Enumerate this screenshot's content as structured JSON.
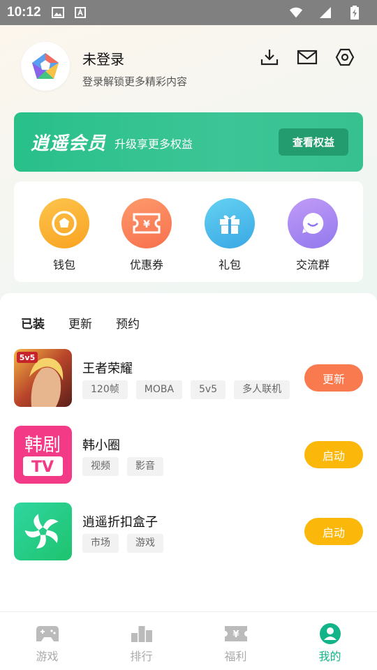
{
  "status_bar": {
    "time": "10:12"
  },
  "profile": {
    "name": "未登录",
    "subtitle": "登录解锁更多精彩内容"
  },
  "vip": {
    "title": "逍遥会员",
    "subtitle": "升级享更多权益",
    "button": "查看权益"
  },
  "quick_actions": [
    {
      "label": "钱包",
      "icon": "wallet-icon",
      "color": "#fba92a"
    },
    {
      "label": "优惠券",
      "icon": "coupon-icon",
      "color": "#fa8060"
    },
    {
      "label": "礼包",
      "icon": "gift-icon",
      "color": "#49bce8"
    },
    {
      "label": "交流群",
      "icon": "chat-icon",
      "color": "#a78af2"
    }
  ],
  "tabs": [
    "已装",
    "更新",
    "预约"
  ],
  "games": [
    {
      "name": "王者荣耀",
      "tags": [
        "120帧",
        "MOBA",
        "5v5",
        "多人联机"
      ],
      "button": "更新",
      "button_color": "#fa7a50"
    },
    {
      "name": "韩小圈",
      "tags": [
        "视频",
        "影音"
      ],
      "button": "启动",
      "button_color": "#fbb80a"
    },
    {
      "name": "逍遥折扣盒子",
      "tags": [
        "市场",
        "游戏"
      ],
      "button": "启动",
      "button_color": "#fbb80a"
    }
  ],
  "bottom_nav": [
    {
      "label": "游戏",
      "icon": "gamepad-icon"
    },
    {
      "label": "排行",
      "icon": "ranking-icon"
    },
    {
      "label": "福利",
      "icon": "ticket-icon"
    },
    {
      "label": "我的",
      "icon": "user-icon",
      "active": true
    }
  ],
  "colors": {
    "accent": "#12b488",
    "vip_green": "#2fc28e"
  }
}
